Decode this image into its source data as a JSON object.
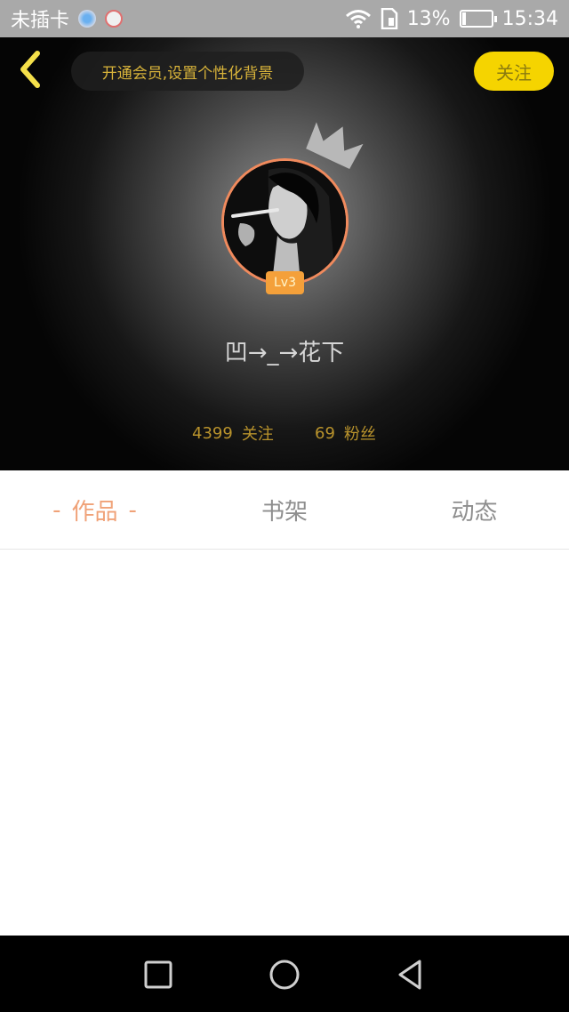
{
  "status_bar": {
    "carrier": "未插卡",
    "battery_percent": "13%",
    "battery_level": 0.13,
    "time": "15:34",
    "icons": [
      "app-icon-a",
      "app-icon-b",
      "wifi-icon",
      "sim-icon",
      "battery-charging-icon"
    ]
  },
  "header": {
    "vip_prompt": "开通会员,设置个性化背景",
    "follow_label": "关注",
    "level": "Lv3",
    "username": "凹→_→花下",
    "following_count": "4399",
    "following_label": "关注",
    "fans_count": "69",
    "fans_label": "粉丝"
  },
  "tabs": [
    {
      "label": "作品",
      "active": true,
      "dash": "-"
    },
    {
      "label": "书架",
      "active": false
    },
    {
      "label": "动态",
      "active": false
    }
  ],
  "colors": {
    "accent_yellow": "#f5d400",
    "tab_active": "#f0a278",
    "avatar_border": "#f08a5d",
    "level_badge": "#f4a03a"
  },
  "nav_bar": {
    "icons": [
      "recent-apps-icon",
      "home-icon",
      "back-icon"
    ]
  }
}
